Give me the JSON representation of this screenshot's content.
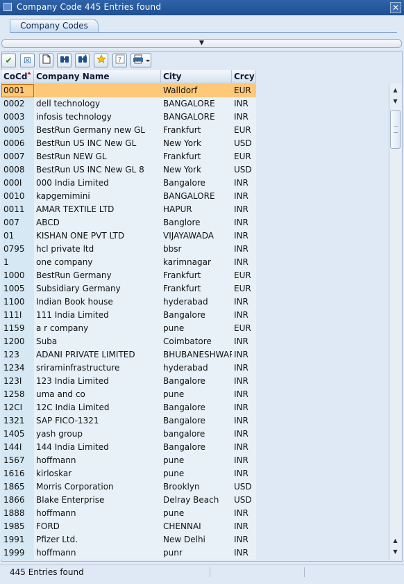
{
  "window": {
    "title": "Company Code  445 Entries found"
  },
  "tab": {
    "label": "Company Codes"
  },
  "toolbar": {
    "icons": [
      "check-icon",
      "cancel-icon",
      "new-document-icon",
      "find-icon",
      "find-next-icon",
      "favorite-icon",
      "help-icon",
      "print-icon"
    ]
  },
  "columns": [
    "CoCd",
    "Company Name",
    "City",
    "Crcy"
  ],
  "rows": [
    [
      "0001",
      "",
      "Walldorf",
      "EUR"
    ],
    [
      "0002",
      "dell technology",
      "BANGALORE",
      "INR"
    ],
    [
      "0003",
      "infosis technology",
      "BANGALORE",
      "INR"
    ],
    [
      "0005",
      "BestRun Germany new GL",
      "Frankfurt",
      "EUR"
    ],
    [
      "0006",
      "BestRun US INC New GL",
      "New York",
      "USD"
    ],
    [
      "0007",
      "BestRun NEW GL",
      "Frankfurt",
      "EUR"
    ],
    [
      "0008",
      "BestRun US INC New GL 8",
      "New York",
      "USD"
    ],
    [
      "000I",
      "000 India Limited",
      "Bangalore",
      "INR"
    ],
    [
      "0010",
      "kapgemimini",
      "BANGALORE",
      "INR"
    ],
    [
      "0011",
      "AMAR TEXTILE LTD",
      "HAPUR",
      "INR"
    ],
    [
      "007",
      "ABCD",
      "Banglore",
      "INR"
    ],
    [
      "01",
      "KISHAN ONE PVT LTD",
      "VIJAYAWADA",
      "INR"
    ],
    [
      "0795",
      "hcl private ltd",
      "bbsr",
      "INR"
    ],
    [
      "1",
      "one company",
      "karimnagar",
      "INR"
    ],
    [
      "1000",
      "BestRun Germany",
      "Frankfurt",
      "EUR"
    ],
    [
      "1005",
      "Subsidiary Germany",
      "Frankfurt",
      "EUR"
    ],
    [
      "1100",
      "Indian Book house",
      "hyderabad",
      "INR"
    ],
    [
      "111I",
      "111 India Limited",
      "Bangalore",
      "INR"
    ],
    [
      "1159",
      "a r company",
      "pune",
      "EUR"
    ],
    [
      "1200",
      "Suba",
      "Coimbatore",
      "INR"
    ],
    [
      "123",
      "ADANI PRIVATE LIMITED",
      "BHUBANESHWAR",
      "INR"
    ],
    [
      "1234",
      "sriraminfrastructure",
      "hyderabad",
      "INR"
    ],
    [
      "123I",
      "123 India Limited",
      "Bangalore",
      "INR"
    ],
    [
      "1258",
      "uma and co",
      "pune",
      "INR"
    ],
    [
      "12CI",
      "12C India Limited",
      "Bangalore",
      "INR"
    ],
    [
      "1321",
      "SAP FICO-1321",
      "Bangalore",
      "INR"
    ],
    [
      "1405",
      "yash group",
      "bangalore",
      "INR"
    ],
    [
      "144I",
      "144 India Limited",
      "Bangalore",
      "INR"
    ],
    [
      "1567",
      "hoffmann",
      "pune",
      "INR"
    ],
    [
      "1616",
      "kirloskar",
      "pune",
      "INR"
    ],
    [
      "1865",
      "Morris Corporation",
      "Brooklyn",
      "USD"
    ],
    [
      "1866",
      "Blake Enterprise",
      "Delray Beach",
      "USD"
    ],
    [
      "1888",
      "hoffmann",
      "pune",
      "INR"
    ],
    [
      "1985",
      "FORD",
      "CHENNAI",
      "INR"
    ],
    [
      "1991",
      "Pfizer Ltd.",
      "New Delhi",
      "INR"
    ],
    [
      "1999",
      "hoffmann",
      "punr",
      "INR"
    ]
  ],
  "selected_row": 0,
  "status": {
    "message": "445 Entries found"
  },
  "colors": {
    "title_bar": "#1e4f93",
    "selected_row": "#fdc877",
    "key_column": "#d5e8f3"
  }
}
